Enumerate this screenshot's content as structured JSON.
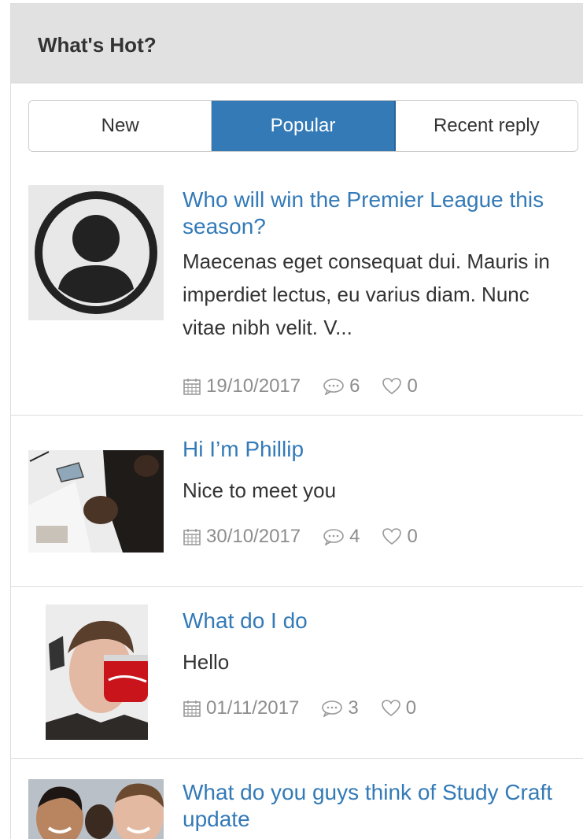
{
  "header": {
    "title": "What's Hot?"
  },
  "tabs": [
    {
      "label": "New",
      "active": false
    },
    {
      "label": "Popular",
      "active": true
    },
    {
      "label": "Recent reply",
      "active": false
    }
  ],
  "posts": [
    {
      "title": "Who will win the Premier League this season?",
      "excerpt": "Maecenas eget consequat dui. Mauris in imperdiet lectus, eu varius diam. Nunc vitae nibh velit. V...",
      "date": "19/10/2017",
      "comments": "6",
      "likes": "0",
      "avatar": "default-user-icon"
    },
    {
      "title": "Hi I’m Phillip",
      "excerpt": "Nice to meet you",
      "date": "30/10/2017",
      "comments": "4",
      "likes": "0",
      "avatar": "photo"
    },
    {
      "title": "What do I do",
      "excerpt": "Hello",
      "date": "01/11/2017",
      "comments": "3",
      "likes": "0",
      "avatar": "photo"
    },
    {
      "title": "What do you guys think of Study Craft update",
      "avatar": "photo"
    }
  ],
  "colors": {
    "accent": "#337ab7",
    "header_bg": "#e1e1e1",
    "meta_text": "#8d8d8d"
  }
}
